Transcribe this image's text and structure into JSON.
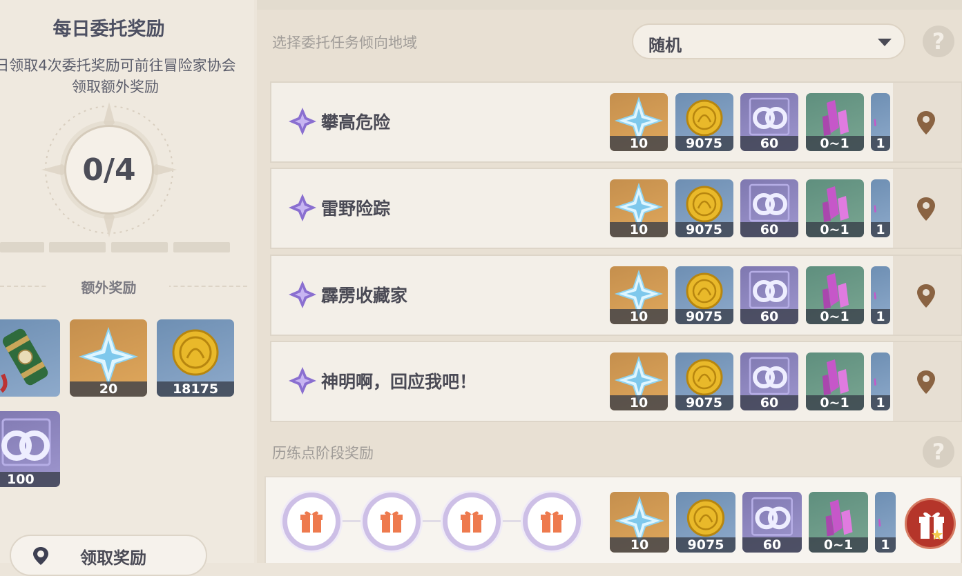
{
  "left_panel": {
    "title": "每日委托奖励",
    "description": "日领取4次委托奖励可前往冒险家协会领取额外奖励",
    "counter": "0/4",
    "progress_segments_filled": 0,
    "progress_segments_total": 4,
    "extra_rewards_label": "额外奖励",
    "extra_rewards": [
      {
        "icon": "scroll-icon",
        "amount": ""
      },
      {
        "icon": "primogem-icon",
        "amount": "20"
      },
      {
        "icon": "mora-icon",
        "amount": "18175"
      },
      {
        "icon": "friendship-exp-icon",
        "amount": "100"
      }
    ],
    "claim_button_label": "领取奖励"
  },
  "main": {
    "region_label": "选择委托任务倾向地域",
    "region_select_value": "随机",
    "commissions": [
      {
        "name": "攀高危险",
        "rewards": [
          "10",
          "9075",
          "60",
          "0~1",
          "1"
        ]
      },
      {
        "name": "雷野险踪",
        "rewards": [
          "10",
          "9075",
          "60",
          "0~1",
          "1"
        ]
      },
      {
        "name": "霹雳收藏家",
        "rewards": [
          "10",
          "9075",
          "60",
          "0~1",
          "1"
        ]
      },
      {
        "name": "神明啊，回应我吧！",
        "rewards": [
          "10",
          "9075",
          "60",
          "0~1",
          "1"
        ]
      }
    ],
    "reward_icons": [
      "primogem-icon",
      "mora-icon",
      "friendship-exp-icon",
      "crystal-icon",
      "extra-item-icon"
    ],
    "training_label": "历练点阶段奖励",
    "training_rewards": [
      "10",
      "9075",
      "60",
      "0~1",
      "1"
    ]
  },
  "colors": {
    "primogem_bg": "#d49b55",
    "mora_bg": "#7d9bbf",
    "exp_bg": "#8f88c2",
    "crystal_bg": "#6a9a87",
    "gift_red": "#b5352a",
    "text_dark": "#4a4a55"
  }
}
